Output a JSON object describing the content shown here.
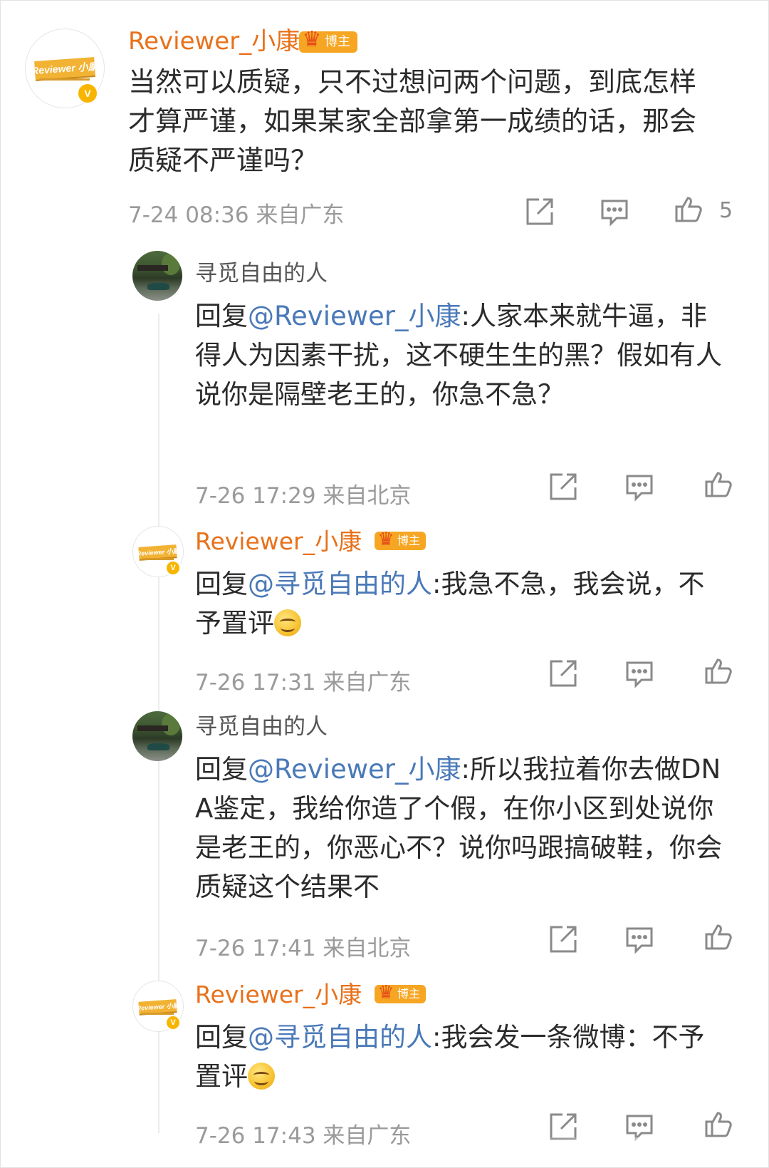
{
  "main_comment": {
    "username": "Reviewer_小康",
    "badge": "博主",
    "avatar_text": "Reviewer 小康",
    "text": "当然可以质疑，只不过想问两个问题，到底怎样才算严谨，如果某家全部拿第一成绩的话，那会质疑不严谨吗？",
    "time": "7-24 08:36",
    "location": "来自广东",
    "like_count": "5"
  },
  "replies": [
    {
      "username": "寻觅自由的人",
      "prefix": "回复",
      "mention": "@Reviewer_小康",
      "text": ":人家本来就牛逼，非得人为因素干扰，这不硬生生的黑？假如有人说你是隔壁老王的，你急不急？",
      "time": "7-26 17:29",
      "location": "来自北京"
    },
    {
      "username": "Reviewer_小康",
      "badge": "博主",
      "avatar_text": "Reviewer 小康",
      "prefix": "回复",
      "mention": "@寻觅自由的人",
      "text": ":我急不急，我会说，不予置评",
      "time": "7-26 17:31",
      "location": "来自广东"
    },
    {
      "username": "寻觅自由的人",
      "prefix": "回复",
      "mention": "@Reviewer_小康",
      "text": ":所以我拉着你去做DNA鉴定，我给你造了个假，在你小区到处说你是老王的，你恶心不？说你吗跟搞破鞋，你会质疑这个结果不",
      "time": "7-26 17:41",
      "location": "来自北京"
    },
    {
      "username": "Reviewer_小康",
      "badge": "博主",
      "avatar_text": "Reviewer 小康",
      "prefix": "回复",
      "mention": "@寻觅自由的人",
      "text": ":我会发一条微博：不予置评",
      "time": "7-26 17:43",
      "location": "来自广东"
    }
  ],
  "icons": {
    "share": "share-icon",
    "comment": "comment-icon",
    "like": "thumbs-up-icon",
    "verified": "verified-v-icon",
    "crown": "crown-icon",
    "emoji": "smile-emoji-icon"
  },
  "colors": {
    "blogger_name": "#e8711a",
    "mention": "#4a79b8",
    "badge": "#f6a623",
    "verified": "#f7b500",
    "meta": "#9a9a9a"
  }
}
